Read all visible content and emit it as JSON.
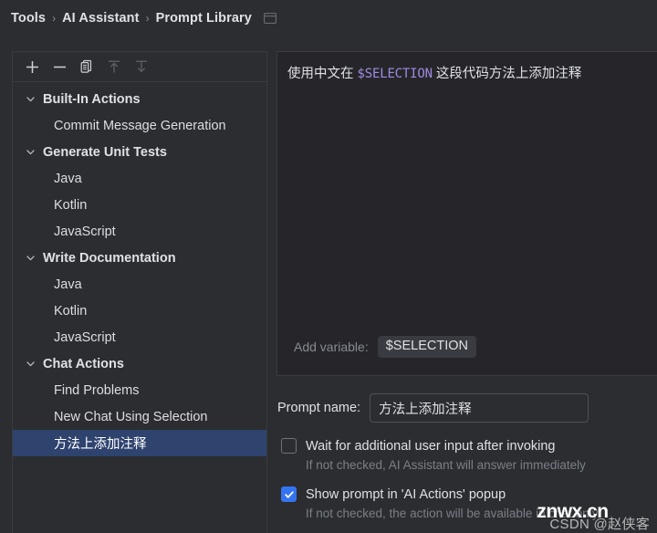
{
  "breadcrumb": {
    "items": [
      "Tools",
      "AI Assistant",
      "Prompt Library"
    ],
    "separator": "›",
    "panel_icon": "window-panel-icon"
  },
  "tree_toolbar": {
    "buttons": [
      {
        "name": "add-prompt-button",
        "icon": "plus-icon",
        "label": "+",
        "enabled": true
      },
      {
        "name": "remove-prompt-button",
        "icon": "minus-icon",
        "label": "−",
        "enabled": true
      },
      {
        "name": "duplicate-prompt-button",
        "icon": "copy-icon",
        "label": "Duplicate",
        "enabled": true
      },
      {
        "name": "import-prompts-button",
        "icon": "upload-arrow-icon",
        "label": "Import",
        "enabled": false
      },
      {
        "name": "export-prompts-button",
        "icon": "download-arrow-icon",
        "label": "Export",
        "enabled": false
      }
    ]
  },
  "tree": {
    "rows": [
      {
        "label": "Built-In Actions",
        "type": "group",
        "expanded": true,
        "selected": false
      },
      {
        "label": "Commit Message Generation",
        "type": "child",
        "selected": false
      },
      {
        "label": "Generate Unit Tests",
        "type": "group",
        "expanded": true,
        "selected": false
      },
      {
        "label": "Java",
        "type": "child",
        "selected": false
      },
      {
        "label": "Kotlin",
        "type": "child",
        "selected": false
      },
      {
        "label": "JavaScript",
        "type": "child",
        "selected": false
      },
      {
        "label": "Write Documentation",
        "type": "group",
        "expanded": true,
        "selected": false
      },
      {
        "label": "Java",
        "type": "child",
        "selected": false
      },
      {
        "label": "Kotlin",
        "type": "child",
        "selected": false
      },
      {
        "label": "JavaScript",
        "type": "child",
        "selected": false
      },
      {
        "label": "Chat Actions",
        "type": "group",
        "expanded": true,
        "selected": false
      },
      {
        "label": "Find Problems",
        "type": "child",
        "selected": false
      },
      {
        "label": "New Chat Using Selection",
        "type": "child",
        "selected": false
      },
      {
        "label": "方法上添加注释",
        "type": "child",
        "selected": true
      }
    ]
  },
  "editor": {
    "text_before": "使用中文在",
    "variable": "$SELECTION",
    "text_after": "这段代码方法上添加注释",
    "add_variable_label": "Add variable:",
    "add_variable_value": "$SELECTION"
  },
  "form": {
    "prompt_name_label": "Prompt name:",
    "prompt_name_value": "方法上添加注释",
    "prompt_name_placeholder": "",
    "wait_checkbox": {
      "label": "Wait for additional user input after invoking",
      "hint": "If not checked, AI Assistant will answer immediately",
      "checked": false
    },
    "show_popup_checkbox": {
      "label": "Show prompt in 'AI Actions' popup",
      "hint": "If not checked, the action will be available in chat only",
      "checked": true
    }
  },
  "watermark": {
    "main": "znwx.cn",
    "sub": "CSDN @赵侠客"
  },
  "colors": {
    "window_bg": "#2b2d30",
    "editor_bg": "#26262a",
    "border": "#393b40",
    "selection_blue": "#2e436e",
    "checkbox_blue": "#3574f0",
    "variable_purple": "#a18ae0",
    "text": "#dfe1e5",
    "muted_text": "#7b7f87"
  }
}
